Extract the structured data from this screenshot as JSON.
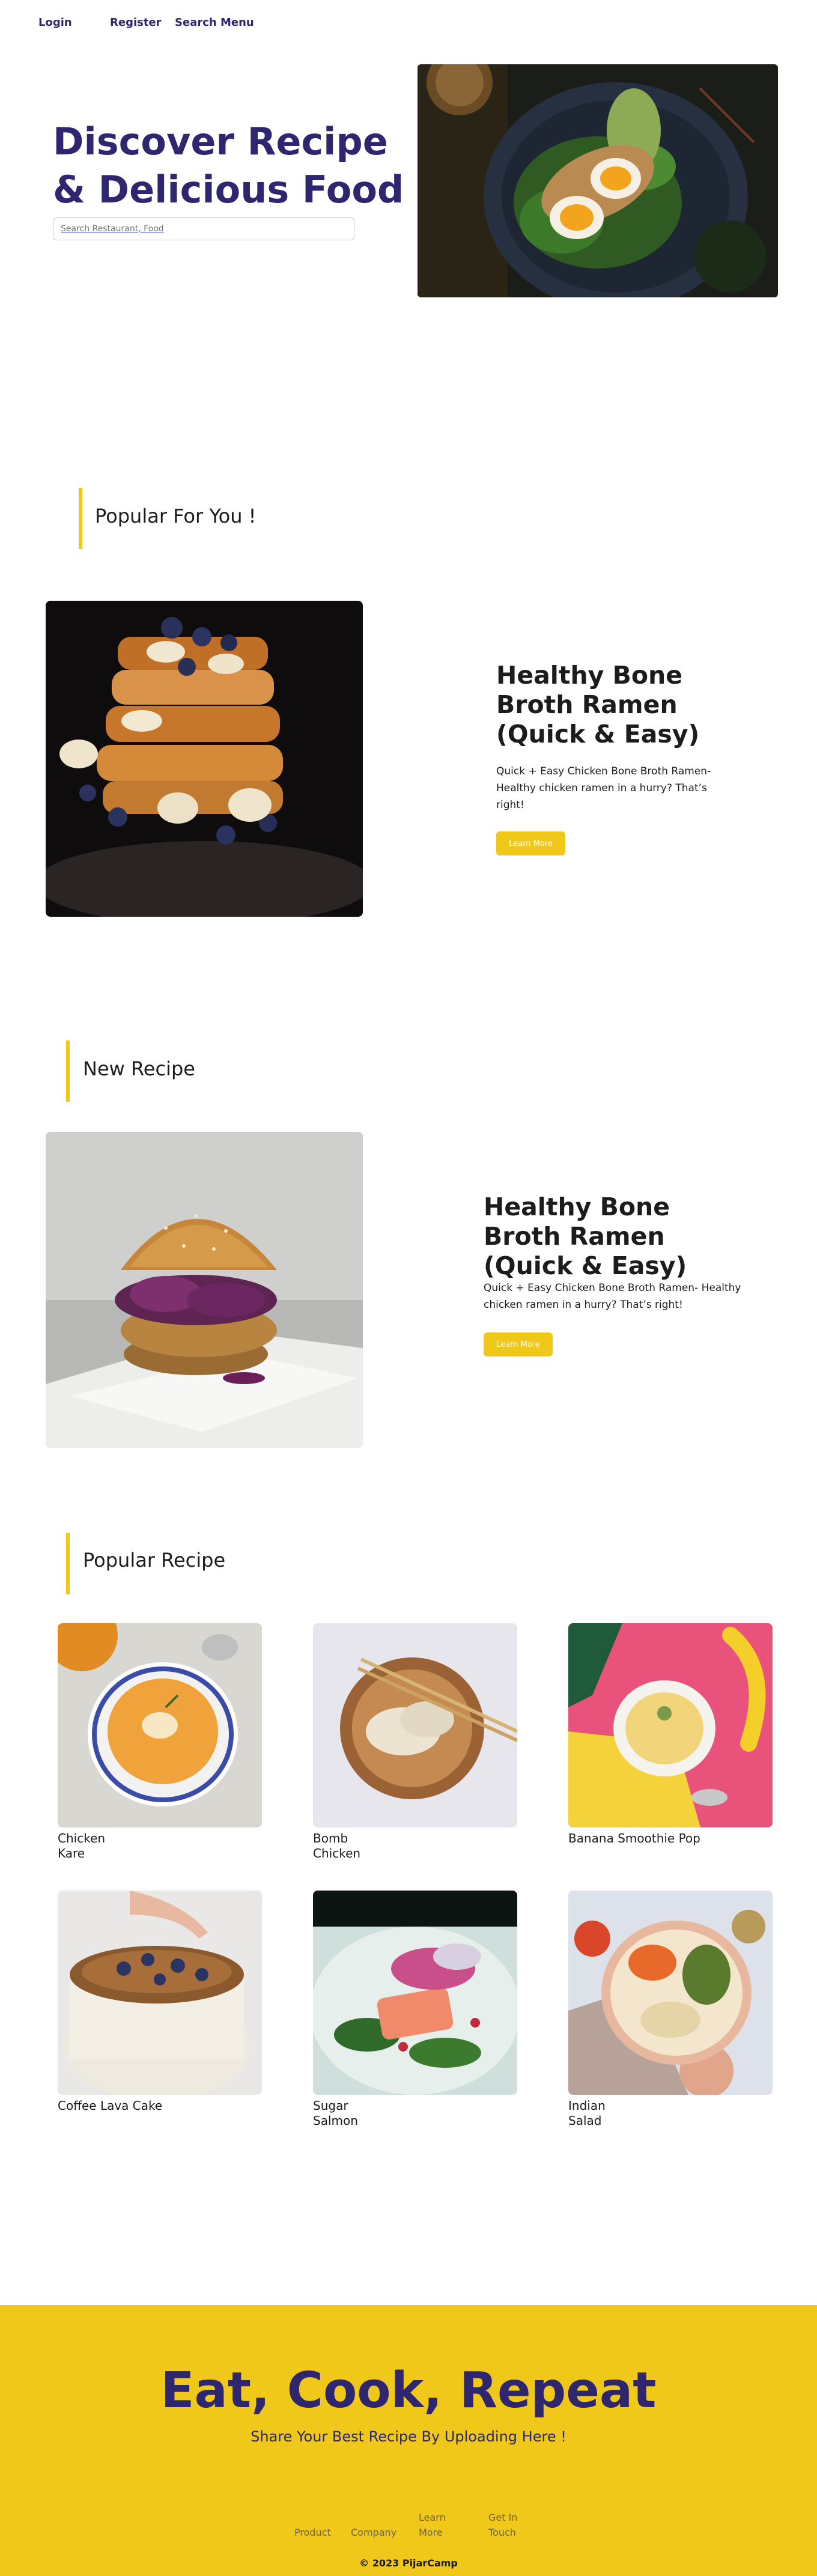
{
  "nav": {
    "login": "Login",
    "register": "Register",
    "search_menu": "Search Menu"
  },
  "hero": {
    "title_line1": "Discover Recipe",
    "title_line2": "& Delicious Food",
    "search_placeholder": "Search Restaurant, Food"
  },
  "popular_for_you": {
    "heading": "Popular For You !",
    "title": "Healthy Bone Broth Ramen (Quick & Easy)",
    "description": "Quick + Easy Chicken Bone Broth Ramen- Healthy chicken ramen in a hurry? That’s right!",
    "button": "Learn More"
  },
  "new_recipe": {
    "heading": "New Recipe",
    "title": "Healthy Bone Broth Ramen (Quick & Easy)",
    "description": "Quick + Easy Chicken Bone Broth Ramen- Healthy chicken ramen in a hurry? That’s right!",
    "button": "Learn More"
  },
  "popular_recipe": {
    "heading": "Popular Recipe",
    "items": [
      {
        "label": "Chicken Kare"
      },
      {
        "label": "Bomb Chicken"
      },
      {
        "label": "Banana Smoothie Pop"
      },
      {
        "label": "Coffee Lava Cake"
      },
      {
        "label": "Sugar Salmon"
      },
      {
        "label": "Indian Salad"
      }
    ]
  },
  "footer": {
    "title": "Eat, Cook, Repeat",
    "subtitle": "Share Your Best Recipe By Uploading Here !",
    "links": [
      "Product",
      "Company",
      "Learn More",
      "Get In Touch"
    ],
    "copyright": "© 2023 PijarCamp"
  },
  "colors": {
    "brand": "#2e266f",
    "accent": "#efc81a"
  }
}
